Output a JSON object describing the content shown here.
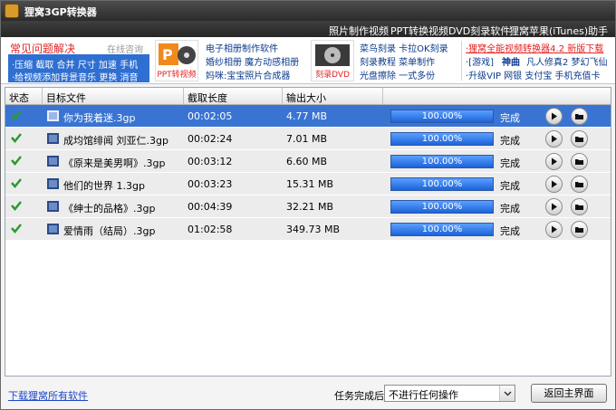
{
  "window": {
    "title": "狸窝3GP转换器"
  },
  "menu": [
    "照片制作视频",
    "PPT转换视频",
    "DVD刻录软件",
    "狸窝苹果(iTunes)助手"
  ],
  "ads": {
    "faq_title": "常见问题解决",
    "consult": "在线咨询",
    "quick_line1": "·压缩  截取  合并  尺寸  加速  手机",
    "quick_line2": "·给视频添加背景音乐  更换  消音",
    "ppt_logo": "PPT转视频",
    "album_links": [
      "电子相册制作软件",
      "婚纱相册  魔方动感相册",
      "妈咪:宝宝照片合成器"
    ],
    "dvd_logo": "刻录DVD",
    "dvd_links": [
      "菜鸟刻录  卡拉OK刻录",
      "刻录教程  菜单制作",
      "光盘擦除  一式多份"
    ],
    "right_line1": "·狸窝全能视频转换器4.2 新版下载",
    "right_line2_a": "·[游戏]",
    "right_line2_b": "神曲",
    "right_line2_c": "凡人修真2  梦幻飞仙",
    "right_line3": "·升级VIP  网银  支付宝  手机充值卡"
  },
  "table": {
    "columns": [
      "状态",
      "目标文件",
      "截取长度",
      "输出大小"
    ],
    "rows": [
      {
        "file": "你为我着迷.3gp",
        "length": "00:02:05",
        "size": "4.77 MB",
        "progress_text": "100.00%",
        "progress": 1.0,
        "status": "完成",
        "selected": true
      },
      {
        "file": "成均馆绯闻 刘亚仁.3gp",
        "length": "00:02:24",
        "size": "7.01 MB",
        "progress_text": "100.00%",
        "progress": 1.0,
        "status": "完成",
        "selected": false
      },
      {
        "file": "《原来是美男啊》.3gp",
        "length": "00:03:12",
        "size": "6.60 MB",
        "progress_text": "100.00%",
        "progress": 1.0,
        "status": "完成",
        "selected": false
      },
      {
        "file": "他们的世界 1.3gp",
        "length": "00:03:23",
        "size": "15.31 MB",
        "progress_text": "100.00%",
        "progress": 1.0,
        "status": "完成",
        "selected": false
      },
      {
        "file": "《绅士的品格》.3gp",
        "length": "00:04:39",
        "size": "32.21 MB",
        "progress_text": "100.00%",
        "progress": 1.0,
        "status": "完成",
        "selected": false
      },
      {
        "file": "爱情雨（结局）.3gp",
        "length": "01:02:58",
        "size": "349.73 MB",
        "progress_text": "100.00%",
        "progress": 1.0,
        "status": "完成",
        "selected": false
      }
    ]
  },
  "footer": {
    "download_link": "下载狸窝所有软件",
    "after_label": "任务完成后:",
    "after_value": "不进行任何操作",
    "back_button": "返回主界面"
  },
  "colors": {
    "selected_row": "#3a74d3",
    "progress": "#1d63d8",
    "check": "#2e9a2e",
    "accent_red": "#e52020"
  }
}
